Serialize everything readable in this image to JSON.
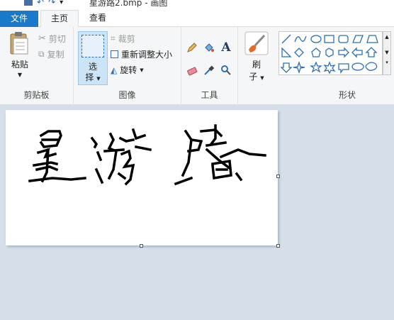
{
  "window": {
    "title": "星游路2.bmp - 画图"
  },
  "tabs": {
    "file": "文件",
    "home": "主页",
    "view": "查看"
  },
  "clipboard": {
    "paste_label": "粘贴",
    "cut_label": "剪切",
    "copy_label": "复制",
    "group_label": "剪贴板"
  },
  "image": {
    "select_label_1": "选",
    "select_label_2": "择",
    "crop_label": "裁剪",
    "resize_label": "重新调整大小",
    "rotate_label": "旋转",
    "group_label": "图像"
  },
  "tools": {
    "group_label": "工具",
    "text_glyph": "A"
  },
  "brushes": {
    "label_1": "刷",
    "label_2": "子"
  },
  "shapes": {
    "group_label": "形状"
  },
  "canvas": {
    "content": "星游路 handwriting (bitmap)"
  },
  "colors": {
    "file_tab": "#1979ca",
    "accent_select": "#cce4f7",
    "workspace": "#d5dfe9"
  }
}
